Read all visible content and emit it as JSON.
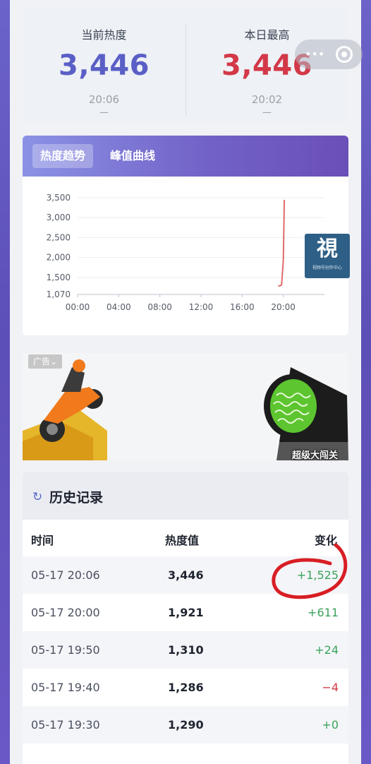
{
  "stats": {
    "current": {
      "label": "当前热度",
      "value": "3,446",
      "time": "20:06",
      "dash": "—"
    },
    "peak": {
      "label": "本日最高",
      "value": "3,446",
      "time": "20:02",
      "dash": "—"
    }
  },
  "capsule": {
    "icons": [
      "more-icon",
      "target-icon"
    ]
  },
  "chart_tabs": {
    "trend": "热度趋势",
    "peak_curve": "峰值曲线"
  },
  "chart_data": {
    "type": "line",
    "x_ticks": [
      "00:00",
      "04:00",
      "08:00",
      "12:00",
      "16:00",
      "20:00"
    ],
    "y_ticks": [
      "3,500",
      "3,000",
      "2,500",
      "2,000",
      "1,500",
      "1,070"
    ],
    "ylim": [
      1070,
      3500
    ],
    "xlim_hours": [
      0,
      24
    ],
    "series": [
      {
        "hours": [
          19.5,
          19.67,
          19.83,
          20.0,
          20.1
        ],
        "values": [
          1290,
          1286,
          1310,
          1921,
          3446
        ]
      }
    ],
    "line_color": "#e06a6a",
    "grid": true
  },
  "watermark": {
    "glyph": "視",
    "sub": "视频号创作中心"
  },
  "ad": {
    "tag": "广告",
    "caption": "超级大闯关"
  },
  "history": {
    "title": "历史记录",
    "columns": {
      "time": "时间",
      "heat": "热度值",
      "change": "变化"
    },
    "rows": [
      {
        "time": "05-17 20:06",
        "heat": "3,446",
        "change": "+1,525",
        "sign": "pos"
      },
      {
        "time": "05-17 20:00",
        "heat": "1,921",
        "change": "+611",
        "sign": "pos"
      },
      {
        "time": "05-17 19:50",
        "heat": "1,310",
        "change": "+24",
        "sign": "pos"
      },
      {
        "time": "05-17 19:40",
        "heat": "1,286",
        "change": "−4",
        "sign": "neg"
      },
      {
        "time": "05-17 19:30",
        "heat": "1,290",
        "change": "+0",
        "sign": "pos"
      }
    ]
  },
  "colors": {
    "accent": "#5a5fc6",
    "peak": "#d33848",
    "positive": "#3aa35b",
    "negative": "#d0383f",
    "annotation": "#d81e24"
  }
}
